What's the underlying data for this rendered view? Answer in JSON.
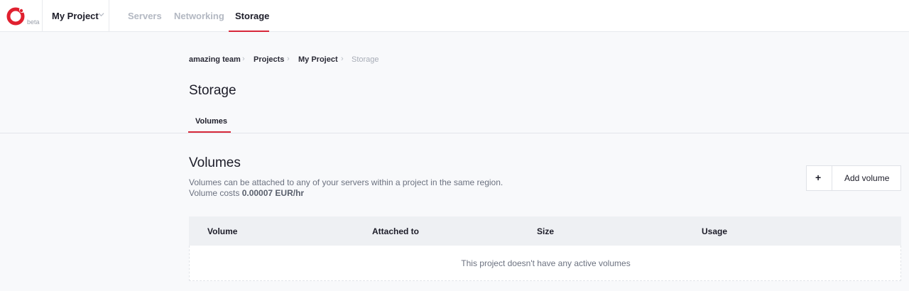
{
  "app": {
    "beta_label": "beta"
  },
  "topbar": {
    "project_name": "My Project",
    "tabs": [
      {
        "label": "Servers",
        "active": false
      },
      {
        "label": "Networking",
        "active": false
      },
      {
        "label": "Storage",
        "active": true
      }
    ]
  },
  "breadcrumb": [
    "amazing team",
    "Projects",
    "My Project",
    "Storage"
  ],
  "page": {
    "title": "Storage",
    "subtabs": [
      {
        "label": "Volumes",
        "active": true
      }
    ]
  },
  "volumes": {
    "title": "Volumes",
    "description": "Volumes can be attached to any of your servers within a project in the same region.",
    "cost_prefix": "Volume costs ",
    "cost_value": "0.00007 EUR/hr",
    "add_button": {
      "icon": "+",
      "label": "Add volume"
    },
    "table": {
      "columns": [
        "Volume",
        "Attached to",
        "Size",
        "Usage"
      ],
      "empty_message": "This project doesn't have any active volumes"
    }
  },
  "colors": {
    "accent": "#d7283a",
    "background": "#f8f9fb"
  },
  "icons": [
    "logo-icon",
    "chevron-down-icon",
    "chevron-right-icon",
    "plus-icon"
  ]
}
